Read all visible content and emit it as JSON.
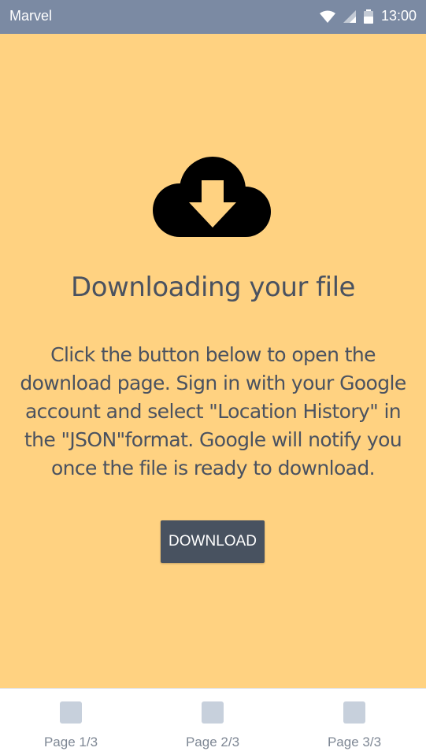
{
  "status_bar": {
    "app_name": "Marvel",
    "time": "13:00",
    "icons": [
      "wifi-icon",
      "signal-icon",
      "battery-icon"
    ]
  },
  "main": {
    "icon": "cloud-download-icon",
    "title": "Downloading your file",
    "description": "Click the button below to open the download page. Sign in with your Google account and select \"Location History\" in the \"JSON\"format. Google will notify you once the file is ready to download.",
    "download_label": "DOWNLOAD"
  },
  "bottom_nav": {
    "items": [
      {
        "label": "Page 1/3",
        "icon": "page-icon"
      },
      {
        "label": "Page 2/3",
        "icon": "page-icon"
      },
      {
        "label": "Page 3/3",
        "icon": "page-icon"
      }
    ]
  },
  "colors": {
    "status_bar": "#7b8aa3",
    "background": "#ffd281",
    "text": "#4a5260",
    "button": "#485260",
    "nav_icon": "#c7d0dc",
    "nav_label": "#7e8794"
  }
}
